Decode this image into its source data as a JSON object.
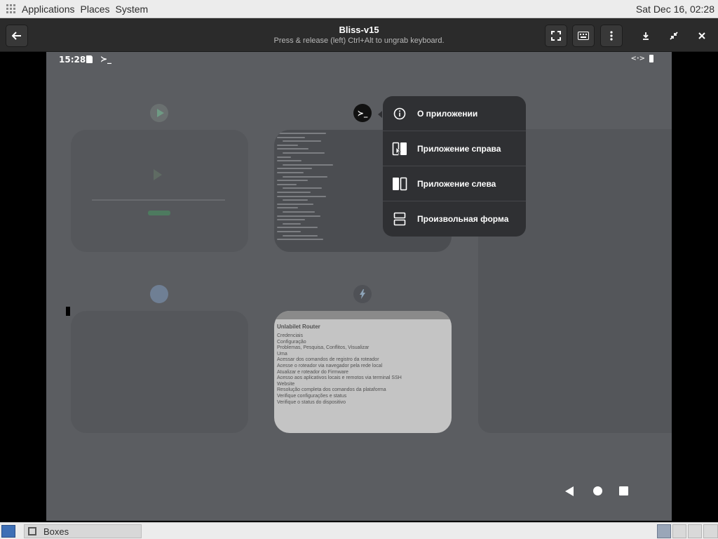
{
  "top_panel": {
    "menus": [
      "Applications",
      "Places",
      "System"
    ],
    "clock": "Sat Dec 16, 02:28"
  },
  "header": {
    "title": "Bliss-v15",
    "subtitle": "Press & release (left) Ctrl+Alt to ungrab keyboard."
  },
  "android": {
    "status_time": "15:28",
    "terminal_glyph": "≻_",
    "browser_preview": {
      "heading": "Unlabilet Router",
      "lines": [
        "Credenciais",
        "Configuração",
        "Problemas, Pesquisa, Conflitos, Visualizar",
        "Uma",
        "Acessar dos comandos de registro da roteador",
        "Acesse o roteador via navegador pela rede local",
        "Atualizar e roteador do Firmware",
        "Acesso aos aplicativos locais e remotos via terminal SSH",
        "Website",
        "Resolução completa dos comandos da plataforma",
        "Verifique configurações e status",
        "Verifique o status do dispositivo"
      ]
    },
    "context_menu": [
      {
        "icon": "info-icon",
        "label": "О приложении"
      },
      {
        "icon": "split-right-icon",
        "label": "Приложение справа"
      },
      {
        "icon": "split-left-icon",
        "label": "Приложение слева"
      },
      {
        "icon": "freeform-icon",
        "label": "Произвольная форма"
      }
    ]
  },
  "taskbar": {
    "task_label": "Boxes"
  }
}
